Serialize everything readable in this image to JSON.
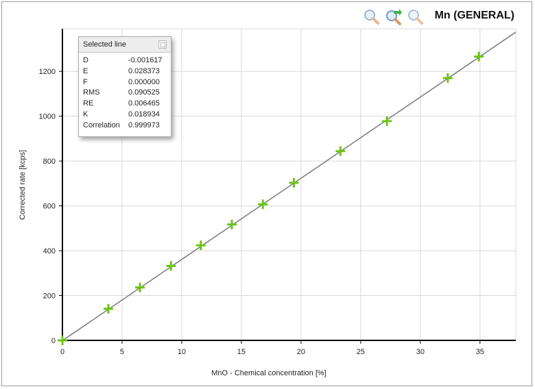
{
  "chart_title": "Mn (GENERAL)",
  "toolbar": {
    "zoom_in_icon": "zoom-in-icon",
    "zoom_reset_icon": "zoom-reset-icon",
    "zoom_out_icon": "zoom-out-icon"
  },
  "panel": {
    "title": "Selected line",
    "rows": [
      {
        "name": "D",
        "value": "-0.001617"
      },
      {
        "name": "E",
        "value": "0.028373"
      },
      {
        "name": "F",
        "value": "0.000000"
      },
      {
        "name": "RMS",
        "value": "0.090525"
      },
      {
        "name": "RE",
        "value": "0.006465"
      },
      {
        "name": "K",
        "value": "0.018934"
      },
      {
        "name": "Correlation",
        "value": "0.999973"
      }
    ]
  },
  "colors": {
    "marker": "#6cc417",
    "fit_line": "#7f7f7f",
    "grid": "#d8d8d8",
    "axis": "#000000"
  },
  "chart_data": {
    "type": "scatter",
    "title": "Mn (GENERAL)",
    "xlabel": "MnO - Chemical concentration [%]",
    "ylabel": "Corrected rate [kcps]",
    "xlim": [
      0,
      38
    ],
    "ylim": [
      0,
      1390
    ],
    "x_ticks": [
      0,
      5,
      10,
      15,
      20,
      25,
      30,
      35
    ],
    "y_ticks": [
      0,
      200,
      400,
      600,
      800,
      1000,
      1200
    ],
    "grid": true,
    "points": [
      {
        "x": 0.0,
        "y": 0
      },
      {
        "x": 3.85,
        "y": 141
      },
      {
        "x": 6.5,
        "y": 236
      },
      {
        "x": 9.1,
        "y": 332
      },
      {
        "x": 11.6,
        "y": 424
      },
      {
        "x": 14.2,
        "y": 517
      },
      {
        "x": 16.8,
        "y": 607
      },
      {
        "x": 19.4,
        "y": 703
      },
      {
        "x": 23.3,
        "y": 844
      },
      {
        "x": 27.2,
        "y": 978
      },
      {
        "x": 32.3,
        "y": 1170
      },
      {
        "x": 34.9,
        "y": 1266
      }
    ],
    "fit_line": {
      "x": [
        0,
        38
      ],
      "y": [
        -1,
        1375
      ]
    }
  }
}
